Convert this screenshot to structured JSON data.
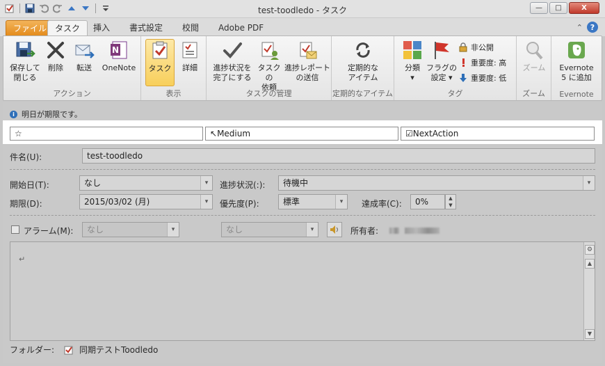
{
  "window": {
    "title": "test-toodledo - タスク",
    "controls": {
      "minimize": "—",
      "maximize": "□",
      "close": "X"
    }
  },
  "tabs": {
    "file": "ファイル",
    "items": [
      "タスク",
      "挿入",
      "書式設定",
      "校閲",
      "Adobe PDF"
    ],
    "help": "?"
  },
  "ribbon": {
    "groups": {
      "action": "アクション",
      "view": "表示",
      "manage": "タスクの管理",
      "recurrence": "定期的なアイテム",
      "tags": "タグ",
      "zoom": "ズーム",
      "evernote": "Evernote"
    },
    "buttons": {
      "save_close": [
        "保存して",
        "閉じる"
      ],
      "delete": "削除",
      "forward": "転送",
      "onenote": "OneNote",
      "task": "タスク",
      "details": "詳細",
      "mark_complete": [
        "進捗状況を",
        "完了にする"
      ],
      "assign": [
        "タスクの",
        "依頼"
      ],
      "send_status": [
        "進捗レポート",
        "の送信"
      ],
      "recurrence": [
        "定期的な",
        "アイテム"
      ],
      "categorize": [
        "分類",
        "▾"
      ],
      "follow_up": [
        "フラグの",
        "設定 ▾"
      ],
      "private": "非公開",
      "high_importance": "重要度: 高",
      "low_importance": "重要度: 低",
      "zoom": "ズーム",
      "evernote_add": [
        "Evernote",
        "5 に追加"
      ]
    }
  },
  "info": {
    "text": "明日が期限です。"
  },
  "tagbar": {
    "star": "☆",
    "priority": "Medium",
    "action": "☑NextAction"
  },
  "form": {
    "subject_label": "件名(U):",
    "subject_value": "test-toodledo",
    "start_label": "開始日(T):",
    "start_value": "なし",
    "status_label": "進捗状況(:):",
    "status_value": "待機中",
    "due_label": "期限(D):",
    "due_value": "2015/03/02 (月)",
    "priority_label": "優先度(P):",
    "priority_value": "標準",
    "percent_label": "達成率(C):",
    "percent_value": "0%",
    "reminder_label": "アラーム(M):",
    "reminder_date": "なし",
    "reminder_time": "なし",
    "owner_label": "所有者:"
  },
  "notes": {
    "content": "↵"
  },
  "footer": {
    "folder_label": "フォルダー:",
    "folder_value": "同期テストToodledo"
  }
}
